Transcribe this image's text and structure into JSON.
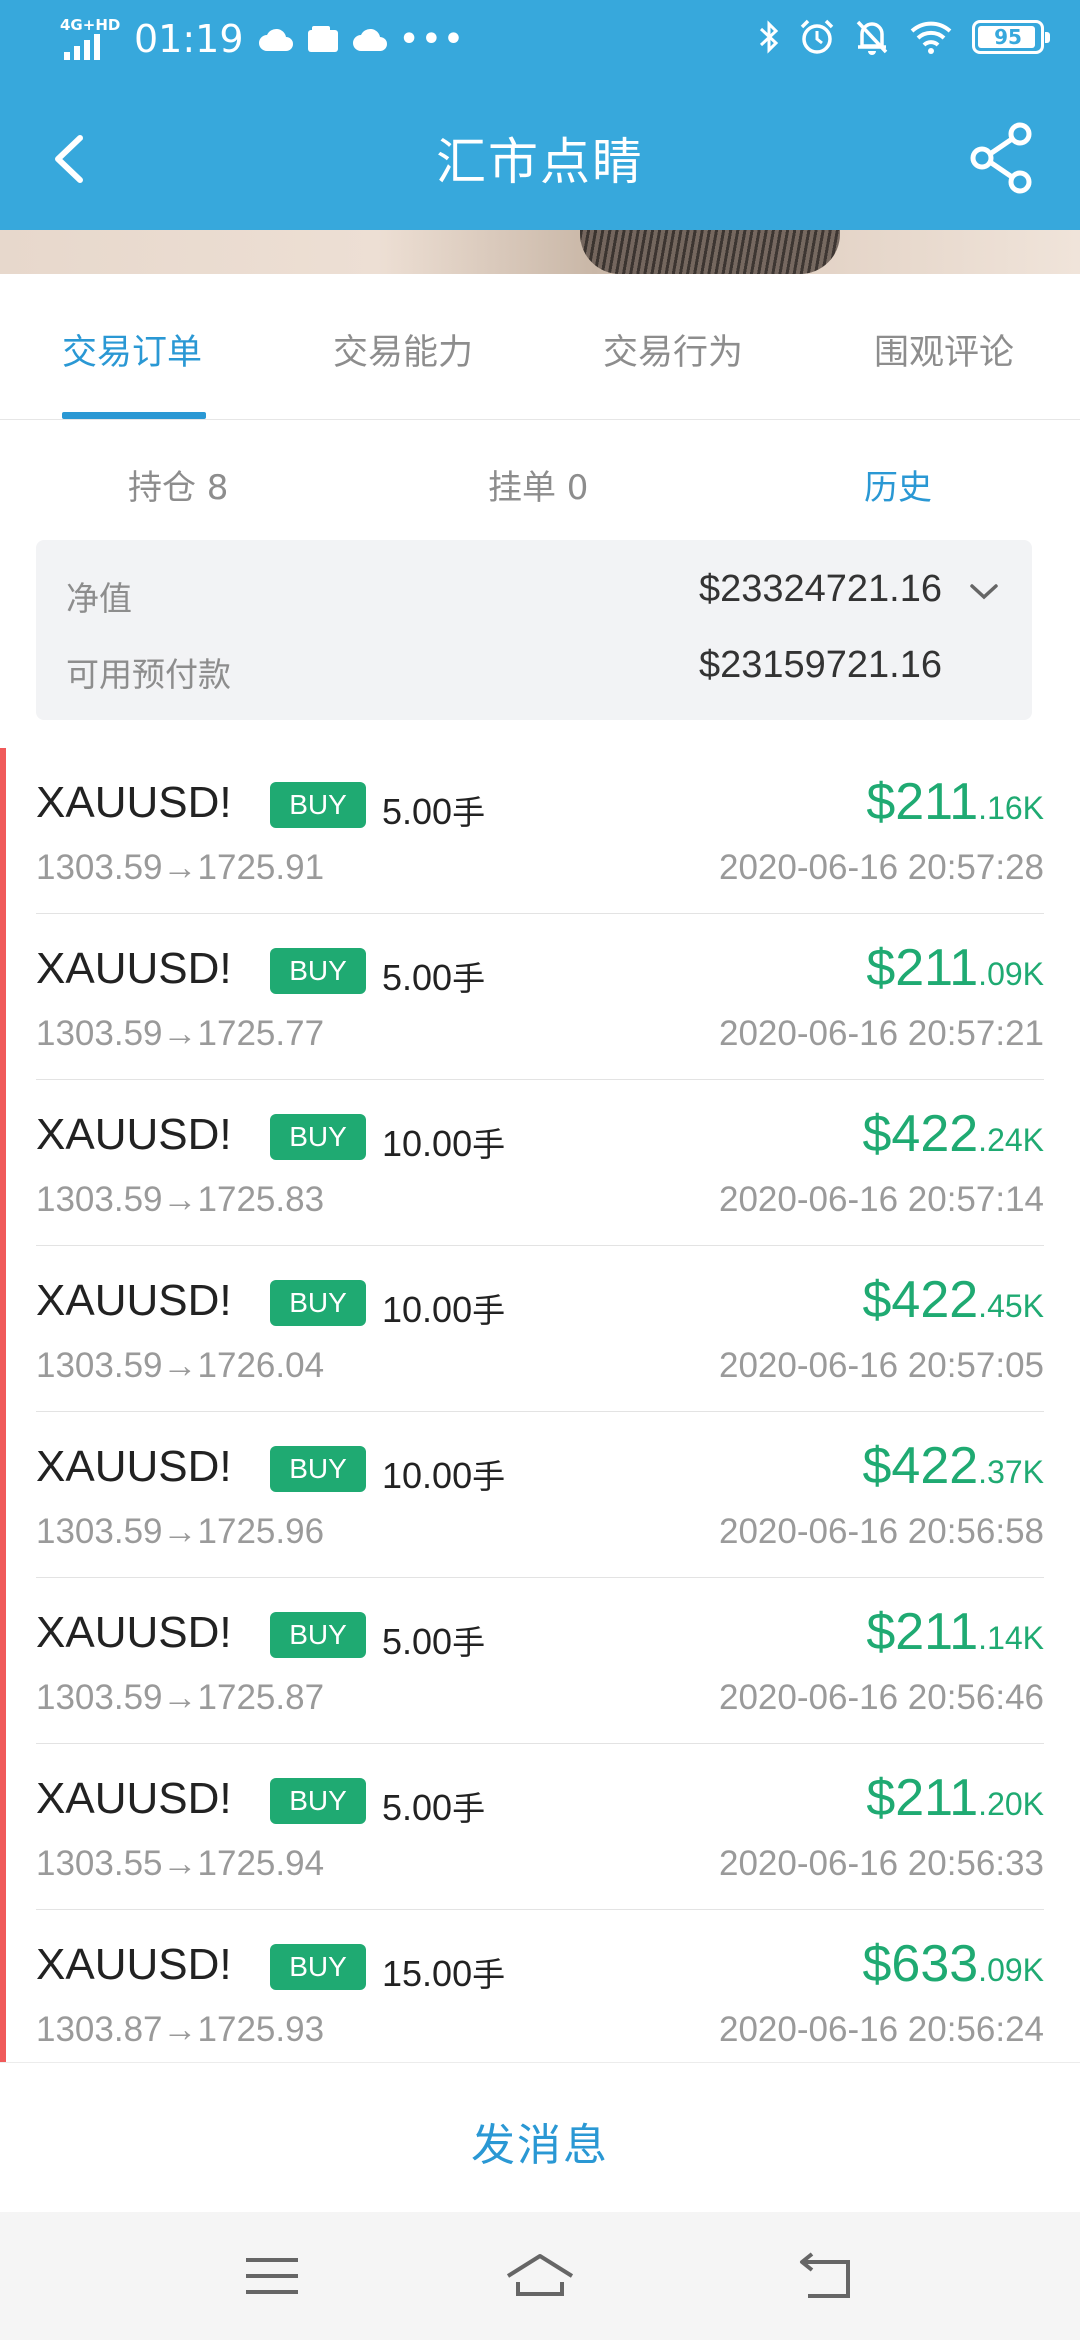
{
  "status_bar": {
    "network": "4G+HD",
    "time": "01:19",
    "battery": "95",
    "battery_level": 0.95,
    "icons": [
      "cloud-icon",
      "wallet-icon",
      "cloud-icon",
      "more-dots-icon",
      "bluetooth-icon",
      "alarm-icon",
      "mute-icon",
      "wifi-icon",
      "battery-icon"
    ]
  },
  "header": {
    "title": "汇市点睛"
  },
  "tabs": [
    {
      "label": "交易订单",
      "active": true
    },
    {
      "label": "交易能力",
      "active": false
    },
    {
      "label": "交易行为",
      "active": false
    },
    {
      "label": "围观评论",
      "active": false
    }
  ],
  "subtabs": [
    {
      "label": "持仓 8",
      "active": false
    },
    {
      "label": "挂单 0",
      "active": false
    },
    {
      "label": "历史",
      "active": true
    }
  ],
  "summary": {
    "net_value_label": "净值",
    "net_value": "$23324721.16",
    "available_label": "可用预付款",
    "available": "$23159721.16"
  },
  "orders": [
    {
      "symbol": "XAUUSD!",
      "side": "BUY",
      "lots": "5.00",
      "unit": "手",
      "prices": "1303.59→1725.91",
      "pnl_main": "$211",
      "pnl_sub": ".16K",
      "time": "2020-06-16 20:57:28"
    },
    {
      "symbol": "XAUUSD!",
      "side": "BUY",
      "lots": "5.00",
      "unit": "手",
      "prices": "1303.59→1725.77",
      "pnl_main": "$211",
      "pnl_sub": ".09K",
      "time": "2020-06-16 20:57:21"
    },
    {
      "symbol": "XAUUSD!",
      "side": "BUY",
      "lots": "10.00",
      "unit": "手",
      "prices": "1303.59→1725.83",
      "pnl_main": "$422",
      "pnl_sub": ".24K",
      "time": "2020-06-16 20:57:14"
    },
    {
      "symbol": "XAUUSD!",
      "side": "BUY",
      "lots": "10.00",
      "unit": "手",
      "prices": "1303.59→1726.04",
      "pnl_main": "$422",
      "pnl_sub": ".45K",
      "time": "2020-06-16 20:57:05"
    },
    {
      "symbol": "XAUUSD!",
      "side": "BUY",
      "lots": "10.00",
      "unit": "手",
      "prices": "1303.59→1725.96",
      "pnl_main": "$422",
      "pnl_sub": ".37K",
      "time": "2020-06-16 20:56:58"
    },
    {
      "symbol": "XAUUSD!",
      "side": "BUY",
      "lots": "5.00",
      "unit": "手",
      "prices": "1303.59→1725.87",
      "pnl_main": "$211",
      "pnl_sub": ".14K",
      "time": "2020-06-16 20:56:46"
    },
    {
      "symbol": "XAUUSD!",
      "side": "BUY",
      "lots": "5.00",
      "unit": "手",
      "prices": "1303.55→1725.94",
      "pnl_main": "$211",
      "pnl_sub": ".20K",
      "time": "2020-06-16 20:56:33"
    },
    {
      "symbol": "XAUUSD!",
      "side": "BUY",
      "lots": "15.00",
      "unit": "手",
      "prices": "1303.87→1725.93",
      "pnl_main": "$633",
      "pnl_sub": ".09K",
      "time": "2020-06-16 20:56:24"
    }
  ],
  "send": {
    "label": "发消息"
  },
  "colors": {
    "header_blue": "#37a8dc",
    "accent_blue": "#2a98d4",
    "profit_green": "#1faa72",
    "side_marker_red": "#f05a5a"
  }
}
